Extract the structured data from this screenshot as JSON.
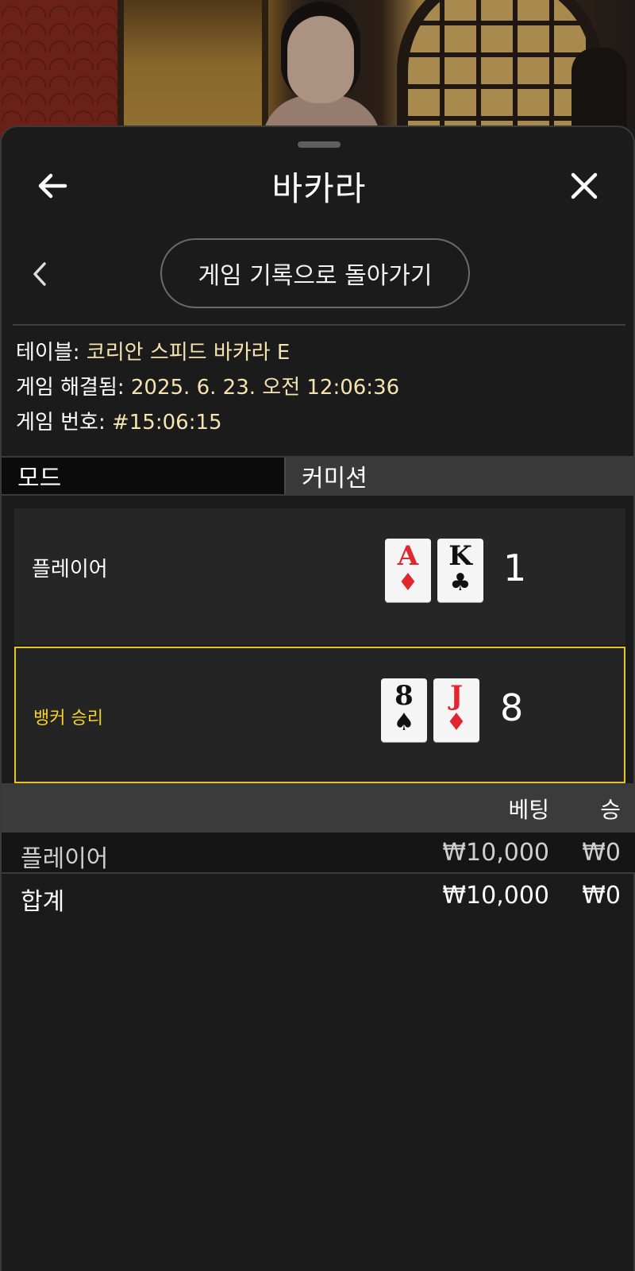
{
  "header": {
    "title": "바카라"
  },
  "nav": {
    "history_button": "게임 기록으로 돌아가기"
  },
  "info": {
    "table_label": "테이블:",
    "table_value": "코리안 스피드 바카라 E",
    "resolved_label": "게임 해결됨:",
    "resolved_value": "2025. 6. 23. 오전 12:06:36",
    "game_no_label": "게임 번호:",
    "game_no_value": "#15:06:15"
  },
  "tabs": [
    {
      "label": "모드",
      "active": true
    },
    {
      "label": "커미션",
      "active": false
    }
  ],
  "results": {
    "player": {
      "label": "플레이어",
      "cards": [
        {
          "rank": "A",
          "suit": "♦",
          "color": "red"
        },
        {
          "rank": "K",
          "suit": "♣",
          "color": "black"
        }
      ],
      "score": "1"
    },
    "banker": {
      "label": "뱅커 승리",
      "cards": [
        {
          "rank": "8",
          "suit": "♠",
          "color": "black"
        },
        {
          "rank": "J",
          "suit": "♦",
          "color": "red"
        }
      ],
      "score": "8"
    }
  },
  "bets": {
    "columns": [
      "베팅",
      "승"
    ],
    "rows": [
      {
        "name": "플레이어",
        "bet": "₩10,000",
        "win": "₩0"
      }
    ],
    "total": {
      "name": "합계",
      "bet": "₩10,000",
      "win": "₩0"
    }
  },
  "colors": {
    "accent_win": "#e3c624",
    "info_value": "#f5e3b0",
    "card_red": "#e0262e"
  }
}
